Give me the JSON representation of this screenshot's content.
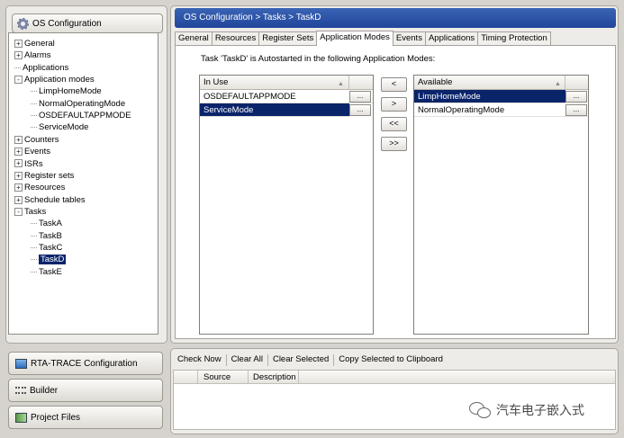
{
  "left": {
    "header": "OS Configuration",
    "tree": [
      {
        "label": "General",
        "expander": "+",
        "indent": 0
      },
      {
        "label": "Alarms",
        "expander": "+",
        "indent": 0
      },
      {
        "label": "Applications",
        "expander": "",
        "indent": 0
      },
      {
        "label": "Application modes",
        "expander": "-",
        "indent": 0
      },
      {
        "label": "LimpHomeMode",
        "expander": "",
        "indent": 1
      },
      {
        "label": "NormalOperatingMode",
        "expander": "",
        "indent": 1
      },
      {
        "label": "OSDEFAULTAPPMODE",
        "expander": "",
        "indent": 1
      },
      {
        "label": "ServiceMode",
        "expander": "",
        "indent": 1
      },
      {
        "label": "Counters",
        "expander": "+",
        "indent": 0
      },
      {
        "label": "Events",
        "expander": "+",
        "indent": 0
      },
      {
        "label": "ISRs",
        "expander": "+",
        "indent": 0
      },
      {
        "label": "Register sets",
        "expander": "+",
        "indent": 0
      },
      {
        "label": "Resources",
        "expander": "+",
        "indent": 0
      },
      {
        "label": "Schedule tables",
        "expander": "+",
        "indent": 0
      },
      {
        "label": "Tasks",
        "expander": "-",
        "indent": 0
      },
      {
        "label": "TaskA",
        "expander": "",
        "indent": 1
      },
      {
        "label": "TaskB",
        "expander": "",
        "indent": 1
      },
      {
        "label": "TaskC",
        "expander": "",
        "indent": 1
      },
      {
        "label": "TaskD",
        "expander": "",
        "indent": 1,
        "selected": true
      },
      {
        "label": "TaskE",
        "expander": "",
        "indent": 1
      }
    ],
    "nav_buttons": [
      {
        "label": "RTA-TRACE Configuration",
        "icon": "monitor-icon"
      },
      {
        "label": "Builder",
        "icon": "builder-icon"
      },
      {
        "label": "Project Files",
        "icon": "files-icon"
      }
    ]
  },
  "main": {
    "breadcrumb": "OS Configuration  >  Tasks  >  TaskD",
    "tabs": [
      "General",
      "Resources",
      "Register Sets",
      "Application Modes",
      "Events",
      "Applications",
      "Timing Protection"
    ],
    "active_tab": "Application Modes",
    "description": "Task 'TaskD' is Autostarted in the following Application Modes:",
    "in_use": {
      "header": "In Use",
      "rows": [
        {
          "label": "OSDEFAULTAPPMODE",
          "selected": false
        },
        {
          "label": "ServiceMode",
          "selected": true
        }
      ]
    },
    "available": {
      "header": "Available",
      "rows": [
        {
          "label": "LimpHomeMode",
          "selected": true
        },
        {
          "label": "NormalOperatingMode",
          "selected": false
        }
      ]
    },
    "ellipsis": "...",
    "move_buttons": [
      "<",
      ">",
      "<<",
      ">>"
    ]
  },
  "bottom": {
    "toolbar": [
      "Check Now",
      "Clear All",
      "Clear Selected",
      "Copy Selected to Clipboard"
    ],
    "columns": [
      "Source",
      "Description"
    ]
  },
  "watermark": "汽车电子嵌入式",
  "colors": {
    "selection": "#0a246a",
    "breadcrumb_bar": "#2a52a8"
  }
}
